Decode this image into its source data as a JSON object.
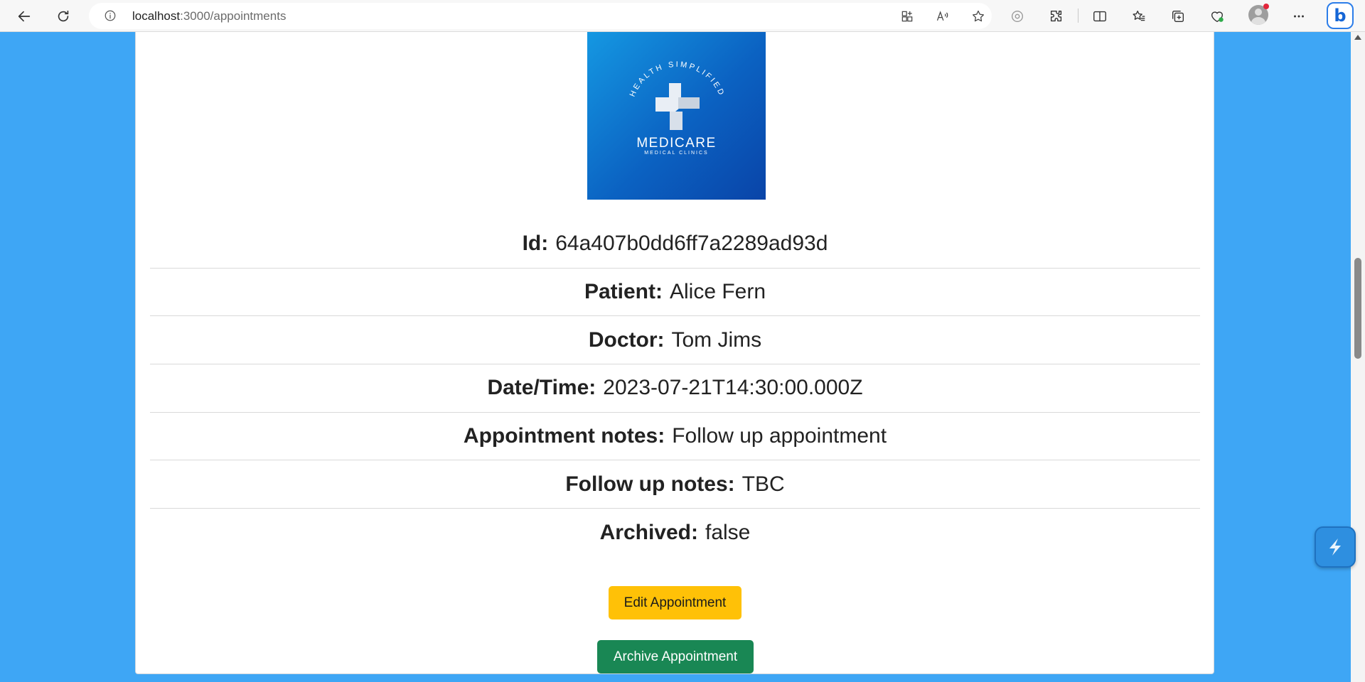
{
  "browser": {
    "url_host": "localhost",
    "url_path": ":3000/appointments",
    "toolbar_icons": [
      "back-icon",
      "refresh-icon",
      "site-info-icon",
      "app-available-icon",
      "read-aloud-icon",
      "favorite-star-icon",
      "extension-icon",
      "puzzle-extensions-icon",
      "split-screen-icon",
      "favorites-icon",
      "collections-icon",
      "browser-essentials-icon",
      "profile-avatar",
      "more-menu-icon",
      "copilot-icon"
    ]
  },
  "logo": {
    "arc_text": "HEALTH SIMPLIFIED",
    "name": "MEDICARE",
    "sub": "MEDICAL CLINICS",
    "colors": {
      "gradient_start": "#1598e2",
      "gradient_end": "#0a44a8"
    }
  },
  "appointment": {
    "fields": [
      {
        "label": "Id:",
        "value": "64a407b0dd6ff7a2289ad93d"
      },
      {
        "label": "Patient:",
        "value": "Alice Fern"
      },
      {
        "label": "Doctor:",
        "value": "Tom Jims"
      },
      {
        "label": "Date/Time:",
        "value": "2023-07-21T14:30:00.000Z"
      },
      {
        "label": "Appointment notes:",
        "value": "Follow up appointment"
      },
      {
        "label": "Follow up notes:",
        "value": "TBC"
      },
      {
        "label": "Archived:",
        "value": "false"
      }
    ]
  },
  "actions": {
    "edit_label": "Edit Appointment",
    "archive_label": "Archive Appointment"
  },
  "colors": {
    "page_background": "#3ea6f5",
    "edit_button": "#ffc107",
    "archive_button": "#198754"
  }
}
